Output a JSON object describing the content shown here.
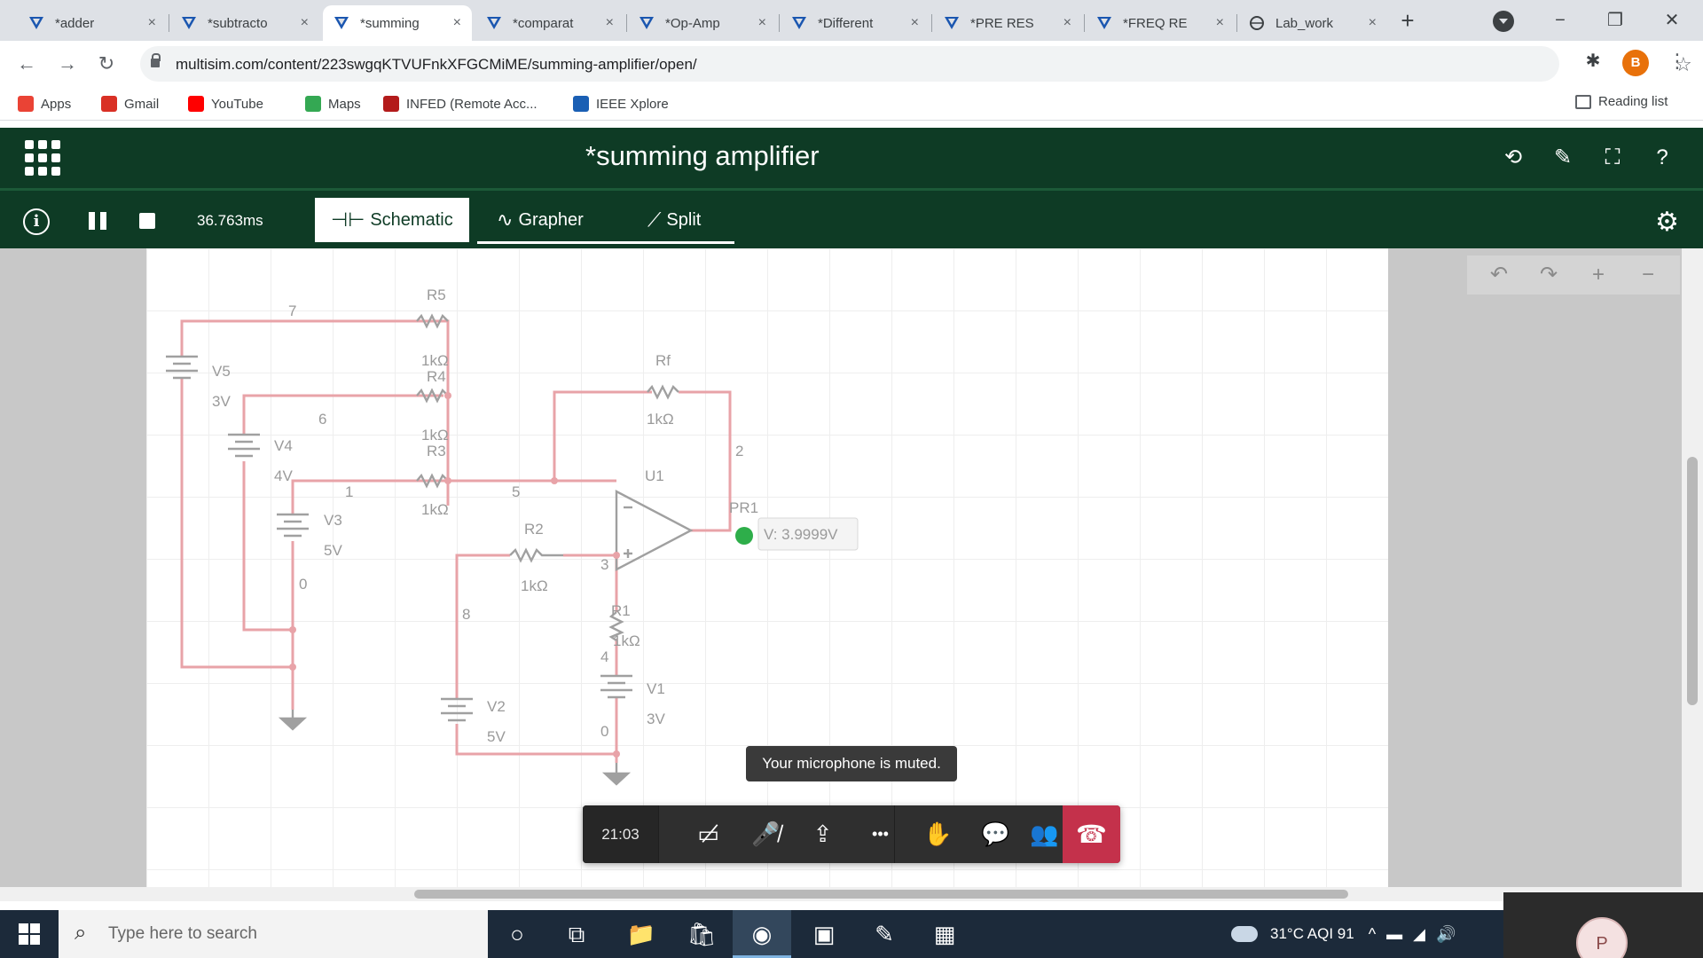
{
  "browser": {
    "tabs": [
      {
        "title": "*adder",
        "active": false
      },
      {
        "title": "*subtracto",
        "active": false
      },
      {
        "title": "*summing",
        "active": true
      },
      {
        "title": "*comparat",
        "active": false
      },
      {
        "title": "*Op-Amp",
        "active": false
      },
      {
        "title": "*Different",
        "active": false
      },
      {
        "title": "*PRE RES",
        "active": false
      },
      {
        "title": "*FREQ RE",
        "active": false
      },
      {
        "title": "Lab_work",
        "active": false
      }
    ],
    "tab_close": "×",
    "new_tab": "+",
    "window_controls": {
      "minimize": "−",
      "restore": "❐",
      "close": "✕"
    },
    "back": "←",
    "forward": "→",
    "reload": "↻",
    "url": "multisim.com/content/223swgqKTVUFnkXFGCMiME/summing-amplifier/open/",
    "star": "☆",
    "extensions": "✱",
    "profile_initial": "B",
    "menu": "⋮",
    "bookmarks": [
      {
        "label": "Apps",
        "color": "#ea4335"
      },
      {
        "label": "Gmail",
        "color": "#d93025"
      },
      {
        "label": "YouTube",
        "color": "#ff0000"
      },
      {
        "label": "Maps",
        "color": "#34a853"
      },
      {
        "label": "INFED (Remote Acc...",
        "color": "#b31b1b"
      },
      {
        "label": "IEEE Xplore",
        "color": "#1a5fb4"
      }
    ],
    "reading_list": "Reading list"
  },
  "app": {
    "title": "*summing amplifier",
    "header_icons": [
      "share-icon",
      "edit-icon",
      "fullscreen-icon",
      "help-icon"
    ],
    "header_glyphs": [
      "⟲",
      "✎",
      "⛶",
      "?"
    ],
    "info": "i",
    "sim_time": "36.763ms",
    "tabs": [
      {
        "label": "Schematic",
        "glyph": "⊣⊢",
        "active": true
      },
      {
        "label": "Grapher",
        "glyph": "∿",
        "active": false
      },
      {
        "label": "Split",
        "glyph": "⟋",
        "active": false
      }
    ],
    "settings": "⚙",
    "tools": [
      "↶",
      "↷",
      "+",
      "−"
    ]
  },
  "schematic": {
    "labels": {
      "r5": "R5",
      "r5v": "1kΩ",
      "r4": "R4",
      "r4v": "1kΩ",
      "r3": "R3",
      "r3v": "1kΩ",
      "rf": "Rf",
      "rfv": "1kΩ",
      "r2": "R2",
      "r2v": "1kΩ",
      "r1": "R1",
      "r1v": "1kΩ",
      "u1": "U1",
      "v5": "V5",
      "v5v": "3V",
      "v4": "V4",
      "v4v": "4V",
      "v3": "V3",
      "v3v": "5V",
      "v2": "V2",
      "v2v": "5V",
      "v1": "V1",
      "v1v": "3V",
      "n7": "7",
      "n6": "6",
      "n1": "1",
      "n5": "5",
      "n2": "2",
      "n0": "0",
      "n8": "8",
      "n3": "3",
      "n4": "4",
      "n0b": "0",
      "probe": "PR1",
      "probe_value": "V: 3.9999V"
    }
  },
  "call": {
    "toast": "Your microphone is muted.",
    "timer": "21:03",
    "buttons": [
      {
        "name": "camera-off-button",
        "glyph": "▭̸"
      },
      {
        "name": "mic-muted-button",
        "glyph": "🎤̸"
      },
      {
        "name": "share-screen-button",
        "glyph": "⇪"
      },
      {
        "name": "more-options-button",
        "glyph": "•••"
      },
      {
        "name": "raise-hand-button",
        "glyph": "✋"
      },
      {
        "name": "chat-button",
        "glyph": "💬"
      },
      {
        "name": "participants-button",
        "glyph": "👥"
      }
    ],
    "hangup": "☎",
    "self_initial": "P"
  },
  "taskbar": {
    "search_placeholder": "Type here to search",
    "search_icon": "⌕",
    "apps": [
      "○",
      "⧉",
      "📁",
      "🛍",
      "◉",
      "▣",
      "✎",
      "▦"
    ],
    "weather": "31°C  AQI 91",
    "tray": [
      "^",
      "▬",
      "◢",
      "🔊"
    ]
  }
}
